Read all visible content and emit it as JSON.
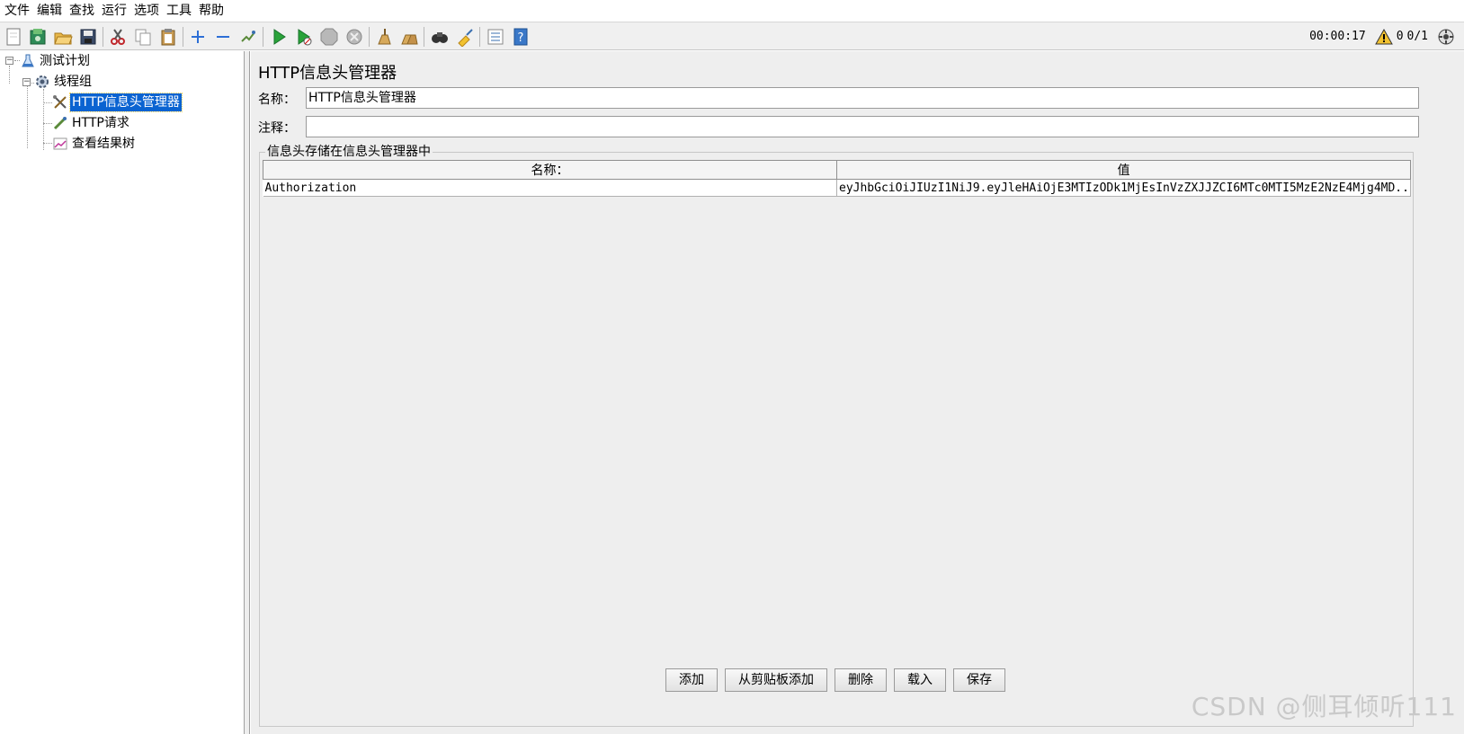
{
  "menu": [
    "文件",
    "编辑",
    "查找",
    "运行",
    "选项",
    "工具",
    "帮助"
  ],
  "toolbar": {
    "icons": [
      "new-icon",
      "templates-icon",
      "open-icon",
      "save-icon",
      "cut-icon",
      "copy-icon",
      "paste-icon",
      "expand-icon",
      "collapse-icon",
      "toggle-icon",
      "start-icon",
      "start-no-pause-icon",
      "stop-icon",
      "shutdown-icon",
      "clear-icon",
      "clear-all-icon",
      "search-icon",
      "reset-search-icon",
      "function-helper-icon",
      "help-icon"
    ],
    "timer": "00:00:17",
    "warning_count": "0",
    "threads": "0/1"
  },
  "tree": {
    "items": [
      {
        "label": "测试计划",
        "icon": "test-plan-icon"
      },
      {
        "label": "线程组",
        "icon": "thread-group-icon"
      },
      {
        "label": "HTTP信息头管理器",
        "icon": "header-manager-icon",
        "selected": true
      },
      {
        "label": "HTTP请求",
        "icon": "http-request-icon"
      },
      {
        "label": "查看结果树",
        "icon": "result-tree-icon"
      }
    ]
  },
  "panel": {
    "title": "HTTP信息头管理器",
    "name_label": "名称：",
    "name_value": "HTTP信息头管理器",
    "comment_label": "注释：",
    "comment_value": "",
    "group_title": "信息头存储在信息头管理器中",
    "table": {
      "columns": [
        "名称：",
        "值"
      ],
      "rows": [
        [
          "Authorization",
          "eyJhbGciOiJIUzI1NiJ9.eyJleHAiOjE3MTIzODk1MjEsInVzZXJJZCI6MTc0MTI5MzE2NzE4Mjg4MD..."
        ]
      ]
    },
    "buttons": [
      "添加",
      "从剪贴板添加",
      "删除",
      "载入",
      "保存"
    ]
  },
  "watermark": "CSDN @侧耳倾听111"
}
